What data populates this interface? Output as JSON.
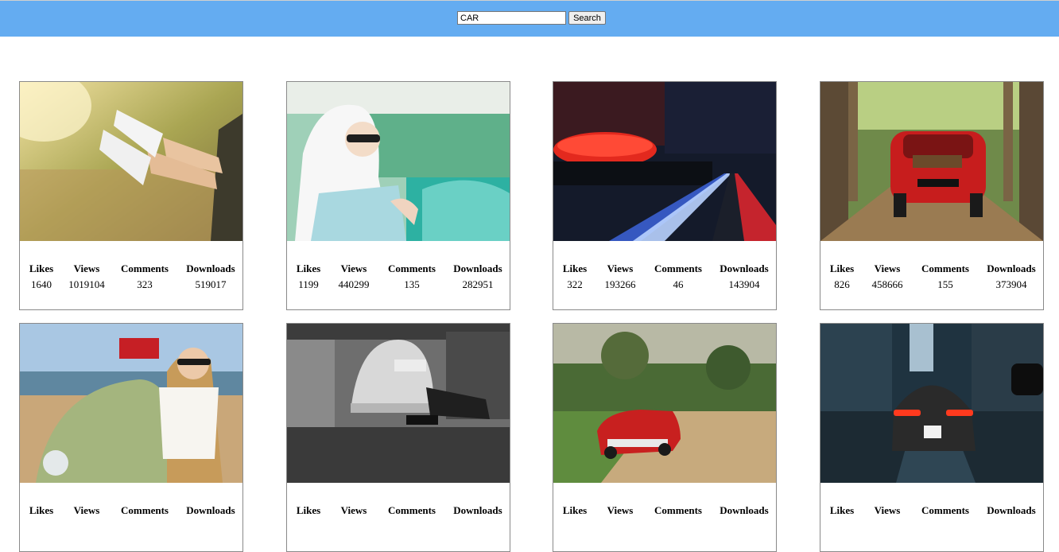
{
  "search": {
    "value": "CAR",
    "button_label": "Search"
  },
  "columns": [
    "Likes",
    "Views",
    "Comments",
    "Downloads"
  ],
  "images": [
    {
      "photo": "legs-out-car-window",
      "likes": "1640",
      "views": "1019104",
      "comments": "323",
      "downloads": "519017"
    },
    {
      "photo": "woman-driving-vintage-car",
      "likes": "1199",
      "views": "440299",
      "comments": "135",
      "downloads": "282951"
    },
    {
      "photo": "stadium-night-light-trails",
      "likes": "322",
      "views": "193266",
      "comments": "46",
      "downloads": "143904"
    },
    {
      "photo": "red-fiat-forest-road",
      "likes": "826",
      "views": "458666",
      "comments": "155",
      "downloads": "373904"
    },
    {
      "photo": "woman-beetle-beach",
      "likes": "",
      "views": "",
      "comments": "",
      "downloads": ""
    },
    {
      "photo": "mechanic-under-beetle-bw",
      "likes": "",
      "views": "",
      "comments": "",
      "downloads": ""
    },
    {
      "photo": "red-classic-car-dirt-road",
      "likes": "",
      "views": "",
      "comments": "",
      "downloads": ""
    },
    {
      "photo": "porsche-rainy-street",
      "likes": "",
      "views": "",
      "comments": "",
      "downloads": ""
    }
  ],
  "colors": {
    "topbar": "#64acf1",
    "card_border": "#8a8a8a"
  }
}
